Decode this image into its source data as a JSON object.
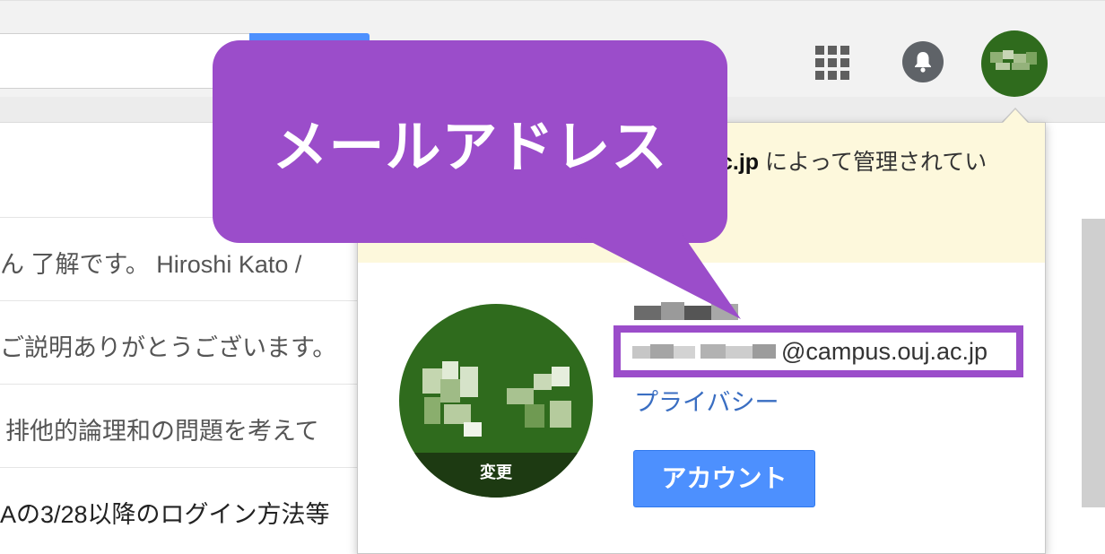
{
  "colors": {
    "callout": "#9b4dca",
    "primary_button": "#4d90fe",
    "notice_bg": "#fdf8dc",
    "avatar": "#2f6b1d",
    "link": "#3a6ec2"
  },
  "header": {
    "icons": [
      "apps-grid-icon",
      "notifications-bell-icon"
    ]
  },
  "mail_list": [
    {
      "snippet": "ん 了解です。 Hiroshi Kato /"
    },
    {
      "snippet": "ご説明ありがとうございます。"
    },
    {
      "snippet": "排他的論理和の問題を考えて"
    },
    {
      "snippet": "Aの3/28以降のログイン方法等"
    }
  ],
  "account_popup": {
    "notice_domain": "c.jp",
    "notice_rest": " によって管理されてい",
    "avatar_change_label": "変更",
    "email_domain": "@campus.ouj.ac.jp",
    "privacy_link": "プライバシー",
    "account_button": "アカウント"
  },
  "callout": {
    "text": "メールアドレス"
  }
}
